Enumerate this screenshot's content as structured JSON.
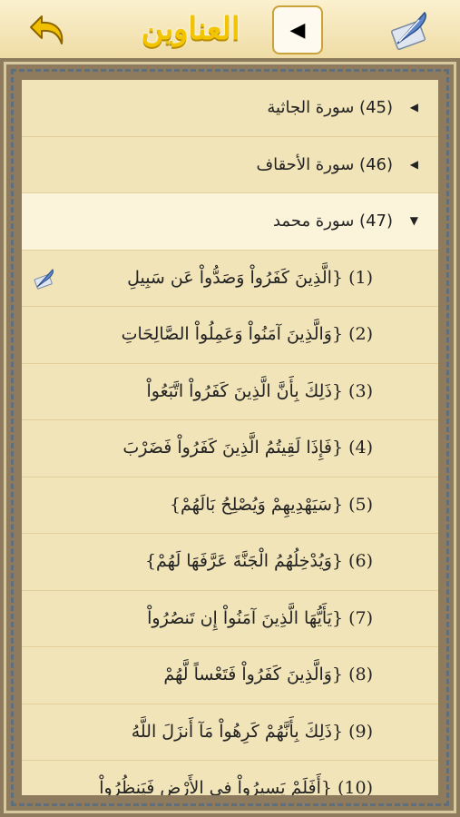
{
  "header": {
    "title": "العناوين",
    "play_symbol": "◀",
    "back_icon": "back-arrow-icon",
    "feather_icon": "feather-icon"
  },
  "surahs": [
    {
      "label": "(45) سورة الجاثية",
      "arrow": "◀"
    },
    {
      "label": "(46) سورة الأحقاف",
      "arrow": "◀"
    },
    {
      "label": "(47) سورة محمد",
      "arrow": "▼"
    }
  ],
  "verses": [
    {
      "label": "(1) {الَّذِينَ كَفَرُواْ وَصَدُّواْ عَن سَبِيلِ"
    },
    {
      "label": "(2) {وَالَّذِينَ آمَنُواْ وَعَمِلُواْ الصَّالِحَاتِ"
    },
    {
      "label": "(3) {ذَلِكَ بِأَنَّ الَّذِينَ كَفَرُواْ اتَّبَعُواْ"
    },
    {
      "label": "(4) {فَإِذَا لَقِيتُمُ الَّذِينَ كَفَرُواْ فَضَرْبَ"
    },
    {
      "label": "(5) {سَيَهْدِيهِمْ وَيُصْلِحُ بَالَهُمْ}"
    },
    {
      "label": "(6) {وَيُدْخِلُهُمُ الْجَنَّةَ عَرَّفَهَا لَهُمْ}"
    },
    {
      "label": "(7) {يَأَيُّهَا الَّذِينَ آمَنُواْ إِن تَنصُرُواْ"
    },
    {
      "label": "(8) {وَالَّذِينَ كَفَرُواْ فَتَعْساً لَّهُمْ"
    },
    {
      "label": "(9) {ذَلِكَ بِأَنَّهُمْ كَرِهُواْ مَآ أَنزَلَ اللَّهُ"
    },
    {
      "label": "(10) {أَفَلَمْ يَسِيرُواْ فِي الأَرْضِ فَيَنظُرُواْ"
    }
  ]
}
